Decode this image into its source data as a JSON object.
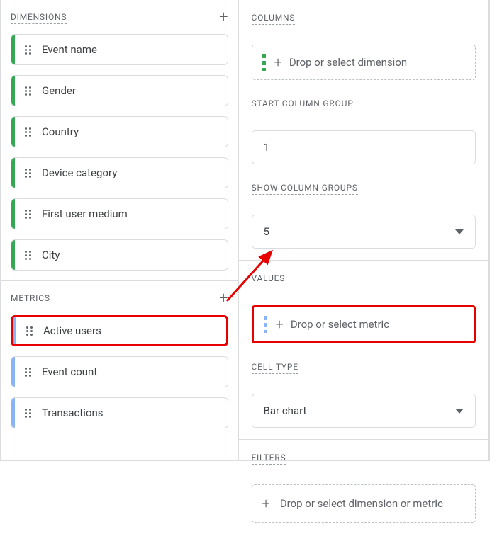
{
  "left": {
    "dimensions": {
      "label": "DIMENSIONS",
      "add": "+",
      "items": [
        {
          "label": "Event name"
        },
        {
          "label": "Gender"
        },
        {
          "label": "Country"
        },
        {
          "label": "Device category"
        },
        {
          "label": "First user medium"
        },
        {
          "label": "City"
        }
      ]
    },
    "metrics": {
      "label": "METRICS",
      "add": "+",
      "items": [
        {
          "label": "Active users"
        },
        {
          "label": "Event count"
        },
        {
          "label": "Transactions"
        }
      ]
    }
  },
  "right": {
    "columns": {
      "label": "COLUMNS",
      "drop_plus": "+",
      "drop_text": "Drop or select dimension"
    },
    "start_group": {
      "label": "START COLUMN GROUP",
      "value": "1"
    },
    "show_groups": {
      "label": "SHOW COLUMN GROUPS",
      "value": "5"
    },
    "values": {
      "label": "VALUES",
      "drop_plus": "+",
      "drop_text": "Drop or select metric"
    },
    "cell_type": {
      "label": "CELL TYPE",
      "value": "Bar chart"
    },
    "filters": {
      "label": "FILTERS",
      "drop_plus": "+",
      "drop_text": "Drop or select dimension or metric"
    }
  }
}
